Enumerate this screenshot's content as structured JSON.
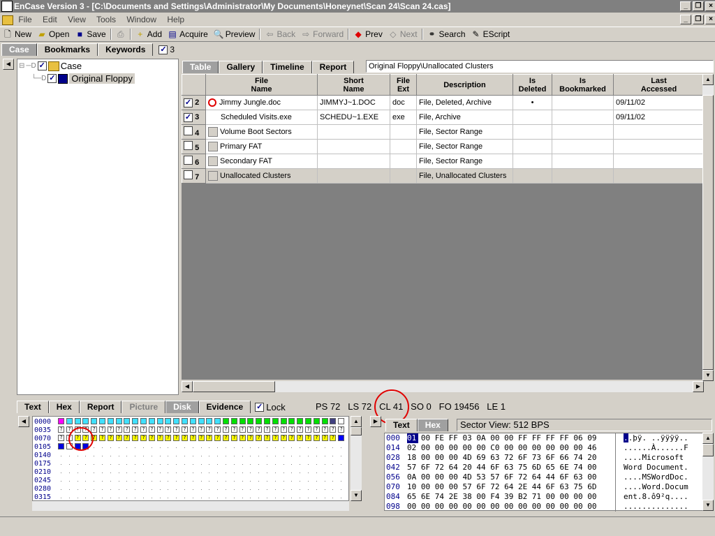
{
  "window": {
    "title": "EnCase Version 3 - [C:\\Documents and Settings\\Administrator\\My Documents\\Honeynet\\Scan 24\\Scan 24.cas]"
  },
  "menu": {
    "items": [
      "File",
      "Edit",
      "View",
      "Tools",
      "Window",
      "Help"
    ]
  },
  "toolbar": {
    "buttons": [
      {
        "label": "New",
        "icon": "new-document-icon"
      },
      {
        "label": "Open",
        "icon": "open-folder-icon"
      },
      {
        "label": "Save",
        "icon": "save-disk-icon"
      },
      {
        "label": "",
        "icon": "print-icon"
      },
      {
        "label": "Add",
        "icon": "add-icon"
      },
      {
        "label": "Acquire",
        "icon": "acquire-icon"
      },
      {
        "label": "Preview",
        "icon": "preview-icon"
      },
      {
        "label": "Back",
        "icon": "back-arrow-icon"
      },
      {
        "label": "Forward",
        "icon": "forward-arrow-icon"
      },
      {
        "label": "Prev",
        "icon": "prev-icon"
      },
      {
        "label": "Next",
        "icon": "next-icon"
      },
      {
        "label": "Search",
        "icon": "binoculars-icon"
      },
      {
        "label": "EScript",
        "icon": "escript-icon"
      }
    ]
  },
  "left_tabs": {
    "case": "Case",
    "bookmarks": "Bookmarks",
    "keywords": "Keywords",
    "count": "3"
  },
  "tree": {
    "root": "Case",
    "child": "Original Floppy"
  },
  "view_tabs": {
    "table": "Table",
    "gallery": "Gallery",
    "timeline": "Timeline",
    "report": "Report",
    "path": "Original Floppy\\Unallocated Clusters"
  },
  "table": {
    "columns": [
      "File\nName",
      "Short\nName",
      "File\nExt",
      "Description",
      "Is\nDeleted",
      "Is\nBookmarked",
      "Last\nAccessed"
    ],
    "rows": [
      {
        "num": "2",
        "checked": true,
        "name": "Jimmy Jungle.doc",
        "short": "JIMMYJ~1.DOC",
        "ext": "doc",
        "desc": "File, Deleted, Archive",
        "deleted": "•",
        "bookmarked": "",
        "accessed": "09/11/02",
        "icon": "deleted-icon"
      },
      {
        "num": "3",
        "checked": true,
        "name": "Scheduled Visits.exe",
        "short": "SCHEDU~1.EXE",
        "ext": "exe",
        "desc": "File, Archive",
        "deleted": "",
        "bookmarked": "",
        "accessed": "09/11/02",
        "icon": ""
      },
      {
        "num": "4",
        "checked": false,
        "name": "Volume Boot Sectors",
        "short": "",
        "ext": "",
        "desc": "File, Sector Range",
        "deleted": "",
        "bookmarked": "",
        "accessed": "",
        "icon": "file-icon"
      },
      {
        "num": "5",
        "checked": false,
        "name": "Primary FAT",
        "short": "",
        "ext": "",
        "desc": "File, Sector Range",
        "deleted": "",
        "bookmarked": "",
        "accessed": "",
        "icon": "file-icon"
      },
      {
        "num": "6",
        "checked": false,
        "name": "Secondary FAT",
        "short": "",
        "ext": "",
        "desc": "File, Sector Range",
        "deleted": "",
        "bookmarked": "",
        "accessed": "",
        "icon": "file-icon"
      },
      {
        "num": "7",
        "checked": false,
        "name": "Unallocated Clusters",
        "short": "",
        "ext": "",
        "desc": "File, Unallocated Clusters",
        "deleted": "",
        "bookmarked": "",
        "accessed": "",
        "icon": "file-icon"
      }
    ]
  },
  "bottom_tabs": {
    "text": "Text",
    "hex": "Hex",
    "report": "Report",
    "picture": "Picture",
    "disk": "Disk",
    "evidence": "Evidence",
    "lock": "Lock"
  },
  "status": {
    "ps": "PS 72",
    "ls": "LS 72",
    "cl": "CL 41",
    "so": "SO 0",
    "fo": "FO 19456",
    "le": "LE 1"
  },
  "disk": {
    "offsets": [
      "0000",
      "0035",
      "0070",
      "0105",
      "0140",
      "0175",
      "0210",
      "0245",
      "0280",
      "0315"
    ]
  },
  "hex": {
    "tab_text": "Text",
    "tab_hex": "Hex",
    "sector_view": "Sector View: 512 BPS",
    "rows": [
      {
        "off": "000",
        "bytes": "01 00 FE FF 03 0A 00 00 FF FF FF FF 06 09",
        "text": "..þÿ. ..ÿÿÿÿ.."
      },
      {
        "off": "014",
        "bytes": "02 00 00 00 00 00 C0 00 00 00 00 00 00 46",
        "text": "......À......F"
      },
      {
        "off": "028",
        "bytes": "18 00 00 00 4D 69 63 72 6F 73 6F 66 74 20",
        "text": "....Microsoft "
      },
      {
        "off": "042",
        "bytes": "57 6F 72 64 20 44 6F 63 75 6D 65 6E 74 00",
        "text": "Word Document."
      },
      {
        "off": "056",
        "bytes": "0A 00 00 00 4D 53 57 6F 72 64 44 6F 63 00",
        "text": "....MSWordDoc."
      },
      {
        "off": "070",
        "bytes": "10 00 00 00 57 6F 72 64 2E 44 6F 63 75 6D",
        "text": "....Word.Docum"
      },
      {
        "off": "084",
        "bytes": "65 6E 74 2E 38 00 F4 39 B2 71 00 00 00 00",
        "text": "ent.8.ô9²q...."
      },
      {
        "off": "098",
        "bytes": "00 00 00 00 00 00 00 00 00 00 00 00 00 00",
        "text": ".............."
      }
    ]
  }
}
